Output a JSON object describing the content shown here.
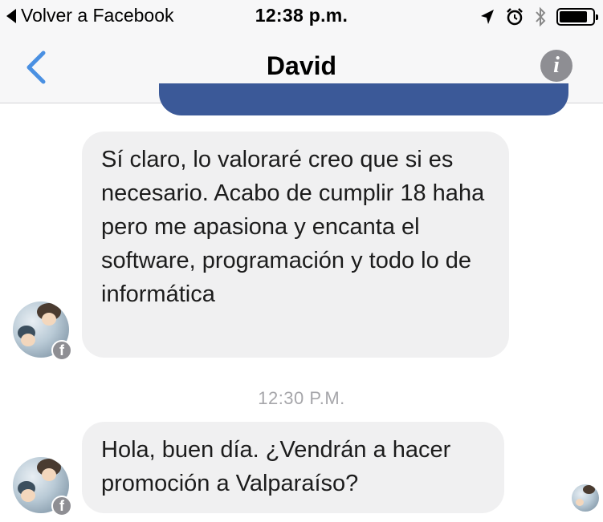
{
  "status_bar": {
    "back_app": "Volver a Facebook",
    "time": "12:38 p.m.",
    "icons": [
      "location-icon",
      "alarm-icon",
      "bluetooth-icon",
      "battery-icon"
    ],
    "battery_level": 0.85
  },
  "nav": {
    "title": "David",
    "back_icon": "chevron-left-icon",
    "info_icon": "info-icon",
    "accent": "#4a90e2"
  },
  "messages": [
    {
      "sender": "David",
      "text": "Sí claro, lo valoraré creo que si es necesario. Acabo de cumplir 18 haha pero me apasiona y encanta el software, programación y todo lo de informática"
    },
    {
      "timestamp": "12:30 P.M."
    },
    {
      "sender": "David",
      "text": "Hola, buen día. ¿Vendrán a hacer promoción a Valparaíso?"
    }
  ],
  "colors": {
    "outgoing_bubble": "#3b5998",
    "incoming_bubble": "#f0f0f1",
    "timestamp": "#a6a6aa"
  },
  "badge": {
    "glyph": "f"
  }
}
